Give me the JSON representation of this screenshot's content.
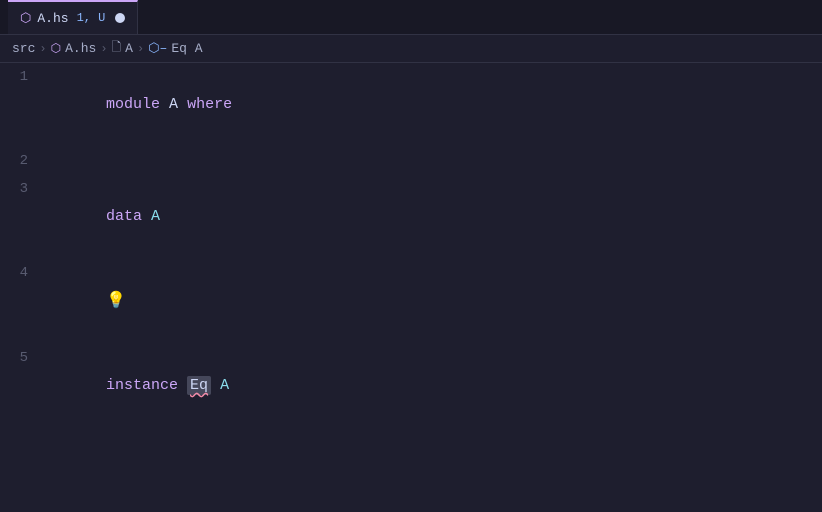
{
  "tab": {
    "icon": "⬡",
    "name": "A.hs",
    "badge": "1, U",
    "unsaved": true
  },
  "breadcrumb": {
    "src": "src",
    "sep1": ">",
    "icon1": "⬡",
    "file": "A.hs",
    "sep2": ">",
    "file_icon": "🗋",
    "module": "A",
    "sep3": ">",
    "link_icon": "⬡",
    "symbol": "Eq A"
  },
  "lines": [
    {
      "num": "1",
      "tokens": [
        {
          "type": "kw-module",
          "text": "module"
        },
        {
          "type": "kw-name",
          "text": " A "
        },
        {
          "type": "kw-where",
          "text": "where"
        }
      ]
    },
    {
      "num": "2",
      "tokens": []
    },
    {
      "num": "3",
      "tokens": [
        {
          "type": "kw-data",
          "text": "data"
        },
        {
          "type": "type-name",
          "text": " A"
        }
      ]
    },
    {
      "num": "4",
      "tokens": [
        {
          "type": "lightbulb",
          "text": "💡"
        }
      ]
    },
    {
      "num": "5",
      "tokens": [
        {
          "type": "kw-instance",
          "text": "instance"
        },
        {
          "type": "highlighted",
          "text": " Eq"
        },
        {
          "type": "kw-name",
          "text": " A"
        }
      ]
    }
  ],
  "colors": {
    "bg": "#1e1e2e",
    "tabbar_bg": "#181825",
    "accent": "#cba6f7",
    "text": "#cdd6f4",
    "muted": "#585b70",
    "squiggly": "#f38ba8",
    "highlight": "#45475a"
  }
}
